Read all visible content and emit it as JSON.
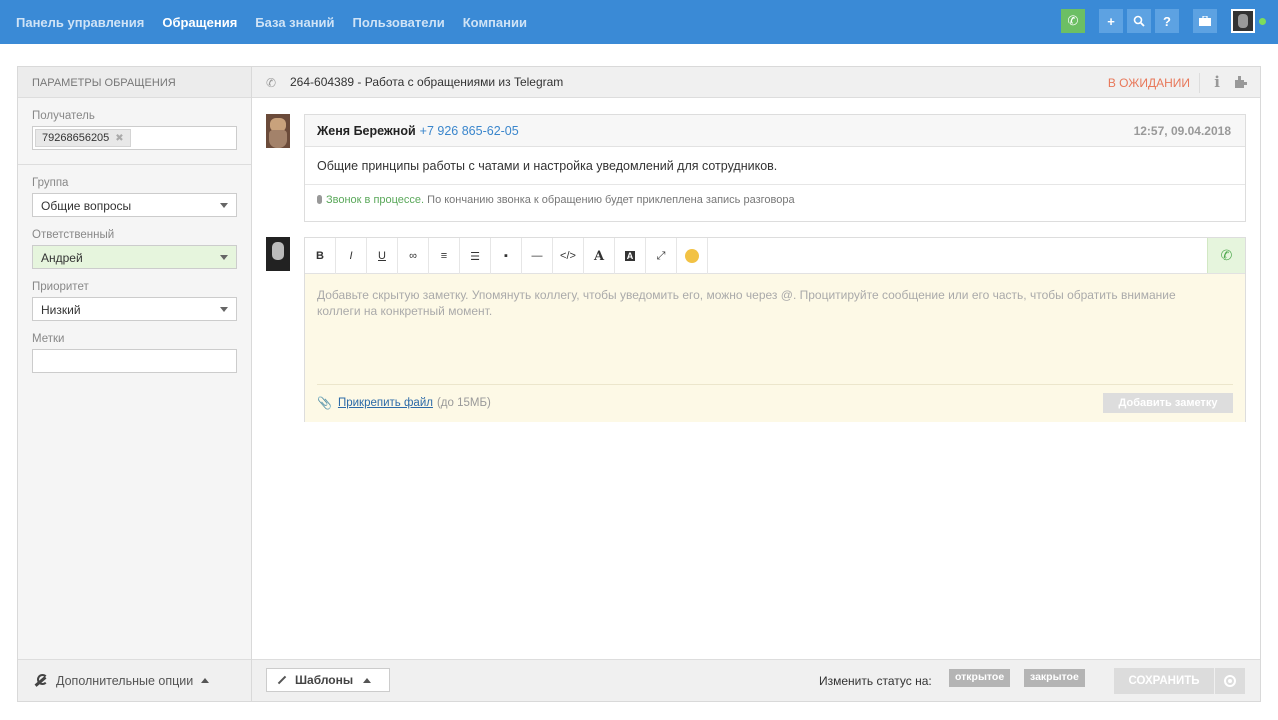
{
  "nav": {
    "items": [
      {
        "label": "Панель управления",
        "active": false
      },
      {
        "label": "Обращения",
        "active": true
      },
      {
        "label": "База знаний",
        "active": false
      },
      {
        "label": "Пользователи",
        "active": false
      },
      {
        "label": "Компании",
        "active": false
      }
    ],
    "icons": [
      "phone-icon",
      "plus-icon",
      "search-icon",
      "help-icon",
      "briefcase-icon",
      "avatar",
      "online-dot"
    ],
    "help_glyph": "?",
    "plus_glyph": "+"
  },
  "left": {
    "header": "ПАРАМЕТРЫ ОБРАЩЕНИЯ",
    "recipient_label": "Получатель",
    "recipient_tag": "79268656205",
    "group_label": "Группа",
    "group_value": "Общие вопросы",
    "assignee_label": "Ответственный",
    "assignee_value": "Андрей",
    "priority_label": "Приоритет",
    "priority_value": "Низкий",
    "tags_label": "Метки",
    "footer_label": "Дополнительные опции"
  },
  "ticket": {
    "title": "264-604389 - Работа с обращениями из Telegram",
    "status": "В ОЖИДАНИИ",
    "info_glyph": "i"
  },
  "message": {
    "author": "Женя Бережной",
    "phone": "+7 926 865-62-05",
    "time": "12:57, 09.04.2018",
    "body": "Общие принципы работы с чатами и настройка уведомлений для сотрудников.",
    "note_status": "Звонок в процессе.",
    "note_text": " По кончанию звонка к обращению будет приклеплена запись разговора"
  },
  "editor": {
    "toolbar": [
      "B",
      "I",
      "U",
      "∞",
      "≡",
      "☰",
      "▪",
      "—",
      "</>",
      "A",
      "A",
      "⤢",
      ""
    ],
    "placeholder": "Добавьте скрытую заметку. Упомянуть коллегу, чтобы уведомить его, можно через @. Процитируйте сообщение или его часть, чтобы обратить внимание коллеги на конкретный момент.",
    "attach_link": "Прикрепить файл",
    "attach_note": "(до 15МБ)",
    "add_note_button": "Добавить заметку"
  },
  "footer": {
    "templates_label": "Шаблоны",
    "change_status_label": "Изменить статус на:",
    "status_open": "открытое",
    "status_closed": "закрытое",
    "save_button": "СОХРАНИТЬ"
  },
  "colors": {
    "topbar": "#3a8ad6",
    "status_wait": "#e8785a",
    "call_green": "#6cbf64",
    "assignee_bg": "#e6f5dd",
    "editor_bg": "#fdf9e6"
  }
}
